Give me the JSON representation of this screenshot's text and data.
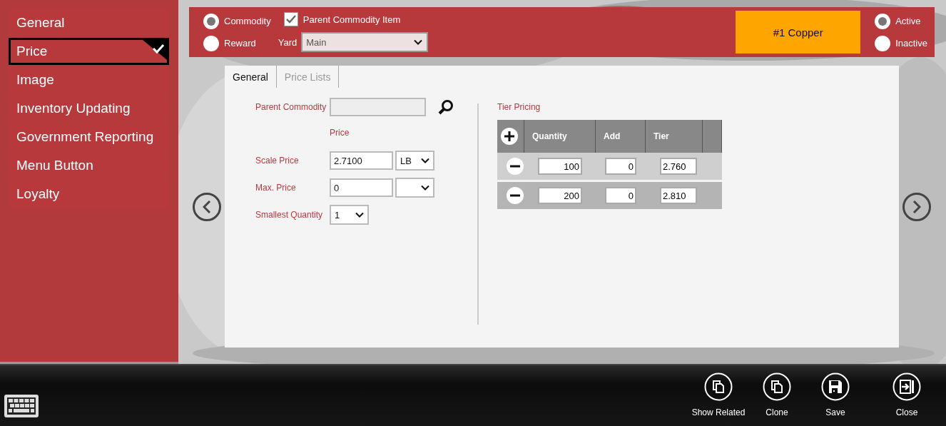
{
  "sidebar": {
    "items": [
      {
        "label": "General",
        "selected": false
      },
      {
        "label": "Price",
        "selected": true
      },
      {
        "label": "Image",
        "selected": false
      },
      {
        "label": "Inventory Updating",
        "selected": false
      },
      {
        "label": "Government Reporting",
        "selected": false
      },
      {
        "label": "Menu Button",
        "selected": false
      },
      {
        "label": "Loyalty",
        "selected": false
      }
    ]
  },
  "header": {
    "type_options": [
      {
        "label": "Commodity",
        "selected": true
      },
      {
        "label": "Reward",
        "selected": false
      }
    ],
    "parent_commodity_item": {
      "label": "Parent Commodity Item",
      "checked": true
    },
    "yard": {
      "label": "Yard",
      "value": "Main"
    },
    "commodity_name": "#1 Copper",
    "status_options": [
      {
        "label": "Active",
        "selected": true
      },
      {
        "label": "Inactive",
        "selected": false
      }
    ]
  },
  "tabs": [
    {
      "label": "General",
      "selected": true
    },
    {
      "label": "Price Lists",
      "selected": false
    }
  ],
  "form": {
    "parent_commodity": {
      "label": "Parent Commodity"
    },
    "price_heading": "Price",
    "scale_price": {
      "label": "Scale Price",
      "value": "2.7100",
      "unit": "LB"
    },
    "max_price": {
      "label": "Max. Price",
      "value": "0"
    },
    "smallest_quantity": {
      "label": "Smallest Quantity",
      "value": "1"
    }
  },
  "tier_pricing": {
    "title": "Tier Pricing",
    "columns": [
      "Quantity",
      "Add",
      "Tier"
    ],
    "rows": [
      {
        "quantity": "100",
        "add": "0",
        "tier": "2.760"
      },
      {
        "quantity": "200",
        "add": "0",
        "tier": "2.810"
      }
    ]
  },
  "toolbar": {
    "buttons": [
      {
        "label": "Show Related",
        "kind": "copy"
      },
      {
        "label": "Clone",
        "kind": "copy"
      },
      {
        "label": "Save",
        "kind": "save"
      },
      {
        "label": "Close",
        "kind": "exit"
      }
    ]
  }
}
